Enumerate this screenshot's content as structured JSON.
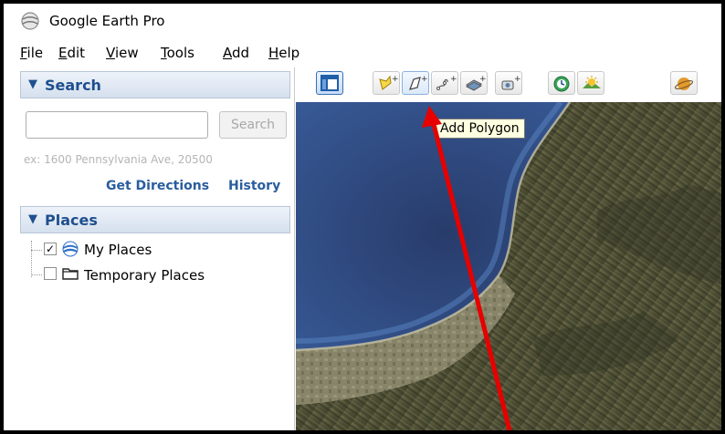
{
  "window": {
    "title": "Google Earth Pro"
  },
  "menu": {
    "items": [
      {
        "acc": "F",
        "rest": "ile"
      },
      {
        "acc": "E",
        "rest": "dit"
      },
      {
        "acc": "V",
        "rest": "iew"
      },
      {
        "acc": "T",
        "rest": "ools"
      },
      {
        "acc": "A",
        "rest": "dd"
      },
      {
        "acc": "H",
        "rest": "elp"
      }
    ]
  },
  "search_panel": {
    "header_arrow": "▼",
    "header": "Search",
    "input_value": "",
    "search_button": "Search",
    "hint": "ex: 1600 Pennsylvania Ave, 20500",
    "get_directions": "Get Directions",
    "history": "History"
  },
  "places_panel": {
    "header_arrow": "▼",
    "header": "Places",
    "items": [
      {
        "label": "My Places",
        "checked": true,
        "check_mark": "✓",
        "icon": "globe-icon"
      },
      {
        "label": "Temporary Places",
        "checked": false,
        "check_mark": "",
        "icon": "folder-icon"
      }
    ]
  },
  "toolbar": {
    "buttons": [
      {
        "name": "hide-sidebar-button",
        "icon": "sidebar-icon"
      },
      {
        "name": "add-placemark-button",
        "icon": "placemark-icon"
      },
      {
        "name": "add-polygon-button",
        "icon": "polygon-icon"
      },
      {
        "name": "add-path-button",
        "icon": "path-icon"
      },
      {
        "name": "add-image-overlay-button",
        "icon": "image-overlay-icon"
      },
      {
        "name": "record-tour-button",
        "icon": "record-tour-icon"
      },
      {
        "name": "historical-imagery-button",
        "icon": "clock-icon"
      },
      {
        "name": "sunlight-button",
        "icon": "sun-icon"
      },
      {
        "name": "planet-switch-button",
        "icon": "planet-icon"
      }
    ],
    "tooltip": "Add Polygon"
  },
  "colors": {
    "accent_blue": "#2a5d9f",
    "annotation_arrow": "#e60000",
    "tooltip_bg": "#ffffe1"
  }
}
